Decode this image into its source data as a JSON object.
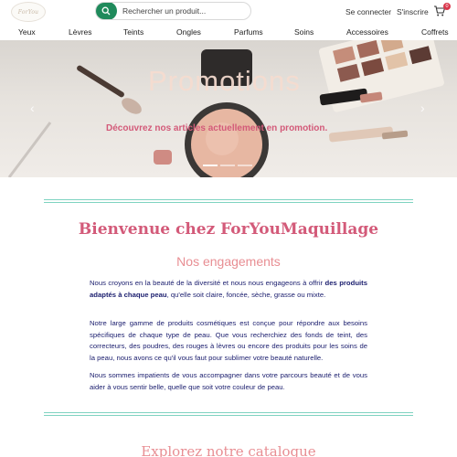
{
  "header": {
    "logo_text": "ForYou",
    "search_placeholder": "Rechercher un produit...",
    "login_label": "Se connecter",
    "signup_label": "S'inscrire",
    "cart_count": "0"
  },
  "nav": {
    "items": [
      "Yeux",
      "Lèvres",
      "Teints",
      "Ongles",
      "Parfums",
      "Soins",
      "Accessoires",
      "Coffrets"
    ]
  },
  "hero": {
    "title": "Promotions",
    "subtitle": "Découvrez nos articles actuellement en promotion.",
    "prev_arrow": "‹",
    "next_arrow": "›"
  },
  "welcome": {
    "title": "Bienvenue chez ForYouMaquillage",
    "subtitle": "Nos engagements",
    "p1_before": "Nous croyons en la beauté de la diversité et nous nous engageons à offrir ",
    "p1_bold": "des produits adaptés à chaque peau",
    "p1_after": ", qu'elle soit claire, foncée, sèche, grasse ou mixte.",
    "p2": "Notre large gamme de produits cosmétiques est conçue pour répondre aux besoins spécifiques de chaque type de peau. Que vous recherchiez des fonds de teint, des correcteurs, des poudres, des rouges à lèvres ou encore des produits pour les soins de la peau, nous avons ce qu'il vous faut pour sublimer votre beauté naturelle.",
    "p3": "Nous sommes impatients de vous accompagner dans votre parcours beauté et de vous aider à vous sentir belle, quelle que soit votre couleur de peau."
  },
  "catalog": {
    "title": "Explorez notre catalogue"
  },
  "colors": {
    "brand_green": "#1f8a5b",
    "accent_pink": "#d35a79",
    "soft_pink": "#e88e93",
    "text_navy": "#1e2170",
    "divider_teal": "#7fd3c1"
  }
}
